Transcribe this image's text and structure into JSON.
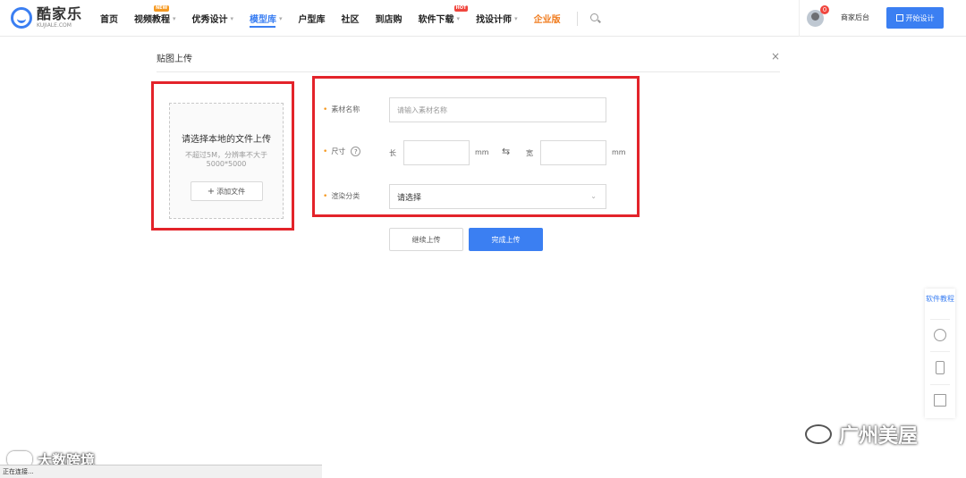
{
  "header": {
    "logo_cn": "酷家乐",
    "logo_en": "KUJIALE.COM",
    "nav": [
      {
        "label": "首页",
        "caret": false
      },
      {
        "label": "视频教程",
        "caret": true,
        "badge": "NEW"
      },
      {
        "label": "优秀设计",
        "caret": true
      },
      {
        "label": "模型库",
        "caret": true,
        "active": true
      },
      {
        "label": "户型库",
        "caret": false
      },
      {
        "label": "社区",
        "caret": false
      },
      {
        "label": "到店购",
        "caret": false
      },
      {
        "label": "软件下载",
        "caret": true,
        "badge": "HOT"
      },
      {
        "label": "找设计师",
        "caret": true
      },
      {
        "label": "企业版",
        "caret": false
      }
    ],
    "notification_count": "0",
    "merchant_label": "商家后台",
    "start_button": "开始设计"
  },
  "modal": {
    "title": "贴图上传",
    "close": "×",
    "upload": {
      "title": "请选择本地的文件上传",
      "hint": "不超过5M，分辨率不大于5000*5000",
      "add_button": "添加文件"
    },
    "form": {
      "name_label": "素材名称",
      "name_placeholder": "请输入素材名称",
      "size_label": "尺寸",
      "length_label": "长",
      "width_label": "宽",
      "unit": "mm",
      "category_label": "渲染分类",
      "category_value": "请选择"
    },
    "buttons": {
      "continue": "继续上传",
      "finish": "完成上传"
    }
  },
  "side_panel": {
    "tutorial": "软件教程"
  },
  "watermarks": {
    "right": "广州美屋",
    "left": "大数跨境"
  },
  "status_bar": "正在连接..."
}
